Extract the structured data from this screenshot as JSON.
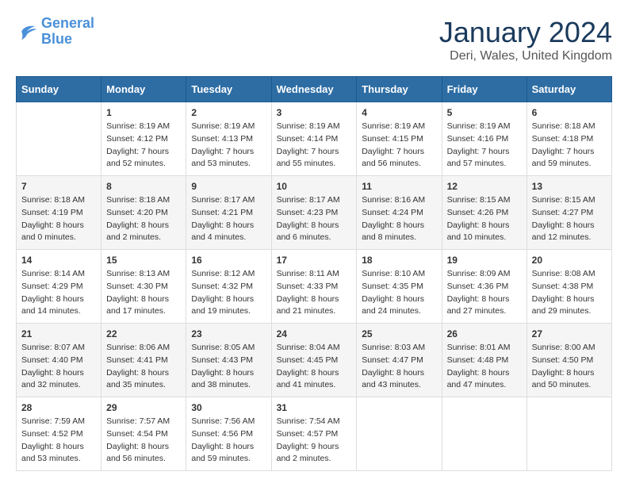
{
  "header": {
    "logo_line1": "General",
    "logo_line2": "Blue",
    "month_title": "January 2024",
    "location": "Deri, Wales, United Kingdom"
  },
  "weekdays": [
    "Sunday",
    "Monday",
    "Tuesday",
    "Wednesday",
    "Thursday",
    "Friday",
    "Saturday"
  ],
  "weeks": [
    [
      {
        "day": "",
        "sunrise": "",
        "sunset": "",
        "daylight": ""
      },
      {
        "day": "1",
        "sunrise": "Sunrise: 8:19 AM",
        "sunset": "Sunset: 4:12 PM",
        "daylight": "Daylight: 7 hours and 52 minutes."
      },
      {
        "day": "2",
        "sunrise": "Sunrise: 8:19 AM",
        "sunset": "Sunset: 4:13 PM",
        "daylight": "Daylight: 7 hours and 53 minutes."
      },
      {
        "day": "3",
        "sunrise": "Sunrise: 8:19 AM",
        "sunset": "Sunset: 4:14 PM",
        "daylight": "Daylight: 7 hours and 55 minutes."
      },
      {
        "day": "4",
        "sunrise": "Sunrise: 8:19 AM",
        "sunset": "Sunset: 4:15 PM",
        "daylight": "Daylight: 7 hours and 56 minutes."
      },
      {
        "day": "5",
        "sunrise": "Sunrise: 8:19 AM",
        "sunset": "Sunset: 4:16 PM",
        "daylight": "Daylight: 7 hours and 57 minutes."
      },
      {
        "day": "6",
        "sunrise": "Sunrise: 8:18 AM",
        "sunset": "Sunset: 4:18 PM",
        "daylight": "Daylight: 7 hours and 59 minutes."
      }
    ],
    [
      {
        "day": "7",
        "sunrise": "Sunrise: 8:18 AM",
        "sunset": "Sunset: 4:19 PM",
        "daylight": "Daylight: 8 hours and 0 minutes."
      },
      {
        "day": "8",
        "sunrise": "Sunrise: 8:18 AM",
        "sunset": "Sunset: 4:20 PM",
        "daylight": "Daylight: 8 hours and 2 minutes."
      },
      {
        "day": "9",
        "sunrise": "Sunrise: 8:17 AM",
        "sunset": "Sunset: 4:21 PM",
        "daylight": "Daylight: 8 hours and 4 minutes."
      },
      {
        "day": "10",
        "sunrise": "Sunrise: 8:17 AM",
        "sunset": "Sunset: 4:23 PM",
        "daylight": "Daylight: 8 hours and 6 minutes."
      },
      {
        "day": "11",
        "sunrise": "Sunrise: 8:16 AM",
        "sunset": "Sunset: 4:24 PM",
        "daylight": "Daylight: 8 hours and 8 minutes."
      },
      {
        "day": "12",
        "sunrise": "Sunrise: 8:15 AM",
        "sunset": "Sunset: 4:26 PM",
        "daylight": "Daylight: 8 hours and 10 minutes."
      },
      {
        "day": "13",
        "sunrise": "Sunrise: 8:15 AM",
        "sunset": "Sunset: 4:27 PM",
        "daylight": "Daylight: 8 hours and 12 minutes."
      }
    ],
    [
      {
        "day": "14",
        "sunrise": "Sunrise: 8:14 AM",
        "sunset": "Sunset: 4:29 PM",
        "daylight": "Daylight: 8 hours and 14 minutes."
      },
      {
        "day": "15",
        "sunrise": "Sunrise: 8:13 AM",
        "sunset": "Sunset: 4:30 PM",
        "daylight": "Daylight: 8 hours and 17 minutes."
      },
      {
        "day": "16",
        "sunrise": "Sunrise: 8:12 AM",
        "sunset": "Sunset: 4:32 PM",
        "daylight": "Daylight: 8 hours and 19 minutes."
      },
      {
        "day": "17",
        "sunrise": "Sunrise: 8:11 AM",
        "sunset": "Sunset: 4:33 PM",
        "daylight": "Daylight: 8 hours and 21 minutes."
      },
      {
        "day": "18",
        "sunrise": "Sunrise: 8:10 AM",
        "sunset": "Sunset: 4:35 PM",
        "daylight": "Daylight: 8 hours and 24 minutes."
      },
      {
        "day": "19",
        "sunrise": "Sunrise: 8:09 AM",
        "sunset": "Sunset: 4:36 PM",
        "daylight": "Daylight: 8 hours and 27 minutes."
      },
      {
        "day": "20",
        "sunrise": "Sunrise: 8:08 AM",
        "sunset": "Sunset: 4:38 PM",
        "daylight": "Daylight: 8 hours and 29 minutes."
      }
    ],
    [
      {
        "day": "21",
        "sunrise": "Sunrise: 8:07 AM",
        "sunset": "Sunset: 4:40 PM",
        "daylight": "Daylight: 8 hours and 32 minutes."
      },
      {
        "day": "22",
        "sunrise": "Sunrise: 8:06 AM",
        "sunset": "Sunset: 4:41 PM",
        "daylight": "Daylight: 8 hours and 35 minutes."
      },
      {
        "day": "23",
        "sunrise": "Sunrise: 8:05 AM",
        "sunset": "Sunset: 4:43 PM",
        "daylight": "Daylight: 8 hours and 38 minutes."
      },
      {
        "day": "24",
        "sunrise": "Sunrise: 8:04 AM",
        "sunset": "Sunset: 4:45 PM",
        "daylight": "Daylight: 8 hours and 41 minutes."
      },
      {
        "day": "25",
        "sunrise": "Sunrise: 8:03 AM",
        "sunset": "Sunset: 4:47 PM",
        "daylight": "Daylight: 8 hours and 43 minutes."
      },
      {
        "day": "26",
        "sunrise": "Sunrise: 8:01 AM",
        "sunset": "Sunset: 4:48 PM",
        "daylight": "Daylight: 8 hours and 47 minutes."
      },
      {
        "day": "27",
        "sunrise": "Sunrise: 8:00 AM",
        "sunset": "Sunset: 4:50 PM",
        "daylight": "Daylight: 8 hours and 50 minutes."
      }
    ],
    [
      {
        "day": "28",
        "sunrise": "Sunrise: 7:59 AM",
        "sunset": "Sunset: 4:52 PM",
        "daylight": "Daylight: 8 hours and 53 minutes."
      },
      {
        "day": "29",
        "sunrise": "Sunrise: 7:57 AM",
        "sunset": "Sunset: 4:54 PM",
        "daylight": "Daylight: 8 hours and 56 minutes."
      },
      {
        "day": "30",
        "sunrise": "Sunrise: 7:56 AM",
        "sunset": "Sunset: 4:56 PM",
        "daylight": "Daylight: 8 hours and 59 minutes."
      },
      {
        "day": "31",
        "sunrise": "Sunrise: 7:54 AM",
        "sunset": "Sunset: 4:57 PM",
        "daylight": "Daylight: 9 hours and 2 minutes."
      },
      {
        "day": "",
        "sunrise": "",
        "sunset": "",
        "daylight": ""
      },
      {
        "day": "",
        "sunrise": "",
        "sunset": "",
        "daylight": ""
      },
      {
        "day": "",
        "sunrise": "",
        "sunset": "",
        "daylight": ""
      }
    ]
  ]
}
